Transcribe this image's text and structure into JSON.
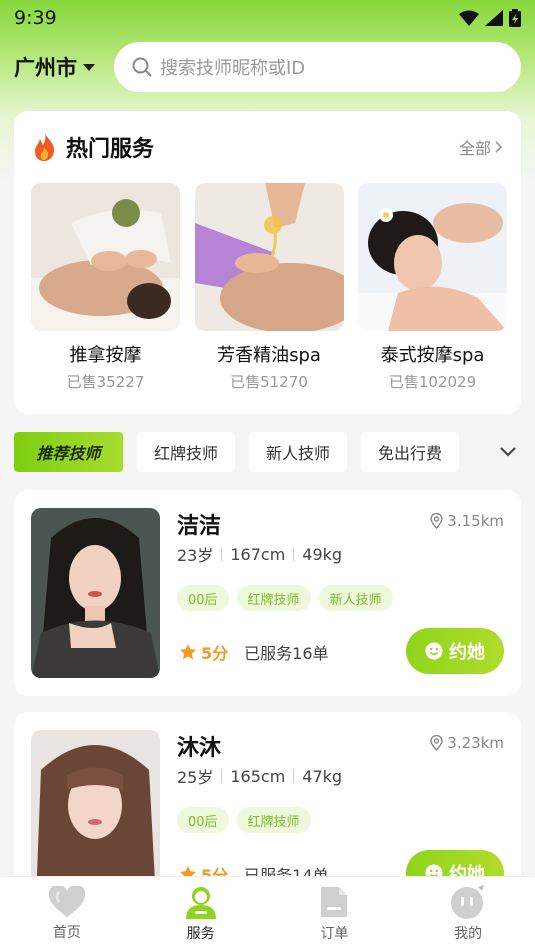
{
  "status": {
    "time": "9:39"
  },
  "header": {
    "city": "广州市",
    "search_placeholder": "搜索技师昵称或ID"
  },
  "hot": {
    "title": "热门服务",
    "all_label": "全部",
    "items": [
      {
        "name": "推拿按摩",
        "sold": "已售35227"
      },
      {
        "name": "芳香精油spa",
        "sold": "已售51270"
      },
      {
        "name": "泰式按摩spa",
        "sold": "已售102029"
      }
    ]
  },
  "filters": {
    "items": [
      "推荐技师",
      "红牌技师",
      "新人技师",
      "免出行费"
    ],
    "active": "推荐技师"
  },
  "techs": [
    {
      "name": "洁洁",
      "distance": "3.15km",
      "age": "23岁",
      "height": "167cm",
      "weight": "49kg",
      "tags": [
        "00后",
        "红牌技师",
        "新人技师"
      ],
      "score": "5分",
      "served": "已服务16单",
      "book_label": "约她"
    },
    {
      "name": "沐沐",
      "distance": "3.23km",
      "age": "25岁",
      "height": "165cm",
      "weight": "47kg",
      "tags": [
        "00后",
        "红牌技师"
      ],
      "score": "5分",
      "served": "已服务14单",
      "book_label": "约她"
    }
  ],
  "tabbar": {
    "items": [
      {
        "label": "首页",
        "icon": "heart-icon"
      },
      {
        "label": "服务",
        "icon": "technician-icon"
      },
      {
        "label": "订单",
        "icon": "order-icon"
      },
      {
        "label": "我的",
        "icon": "profile-face-icon"
      }
    ],
    "active": "服务"
  },
  "colors": {
    "accent": "#8fd41c",
    "accent_text": "#7fbf22",
    "score": "#f39a1e"
  }
}
